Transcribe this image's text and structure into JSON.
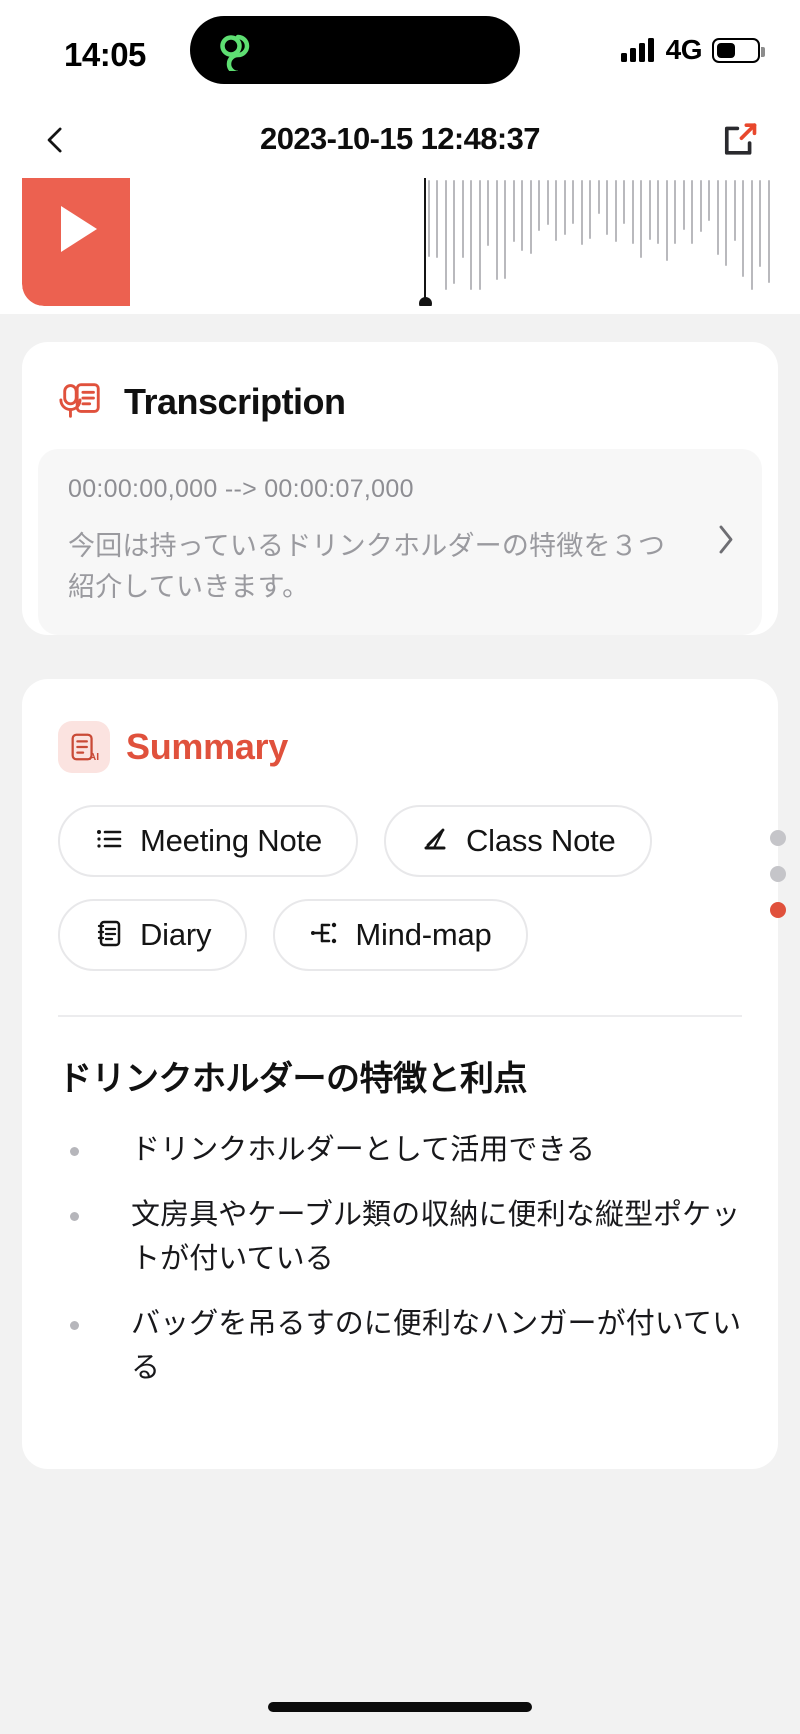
{
  "status_bar": {
    "time": "14:05",
    "network": "4G",
    "island_icon": "green-link-icon",
    "signal_icon": "signal-bars-icon",
    "battery_icon": "battery-icon"
  },
  "nav": {
    "back_icon": "chevron-left-icon",
    "title": "2023-10-15 12:48:37",
    "share_icon": "share-export-icon"
  },
  "player": {
    "play_icon": "play-icon",
    "waveform_icon": "audio-waveform",
    "playhead_icon": "playhead-marker"
  },
  "transcription": {
    "icon": "transcription-mic-doc-icon",
    "title": "Transcription",
    "entries": [
      {
        "timecode": "00:00:00,000 --> 00:00:07,000",
        "text": "今回は持っているドリンクホルダーの特徴を３つ紹介していきます。",
        "chevron_icon": "chevron-right-icon"
      }
    ]
  },
  "summary": {
    "icon": "ai-summary-icon",
    "title": "Summary",
    "chips": [
      {
        "label": "Meeting Note",
        "icon": "list-icon"
      },
      {
        "label": "Class Note",
        "icon": "pencil-icon"
      },
      {
        "label": "Diary",
        "icon": "notebook-icon"
      },
      {
        "label": "Mind-map",
        "icon": "mindmap-icon"
      }
    ],
    "heading": "ドリンクホルダーの特徴と利点",
    "bullets": [
      "ドリンクホルダーとして活用できる",
      "文房具やケーブル類の収納に便利な縦型ポケットが付いている",
      "バッグを吊るすのに便利なハンガーが付いている"
    ]
  },
  "page_dots": {
    "count": 3,
    "active_index": 2
  },
  "colors": {
    "accent_red": "#e0513c",
    "play_coral": "#ec6150",
    "page_bg": "#f2f2f2",
    "card_bg": "#ffffff",
    "muted_text": "#9a9a9f"
  }
}
